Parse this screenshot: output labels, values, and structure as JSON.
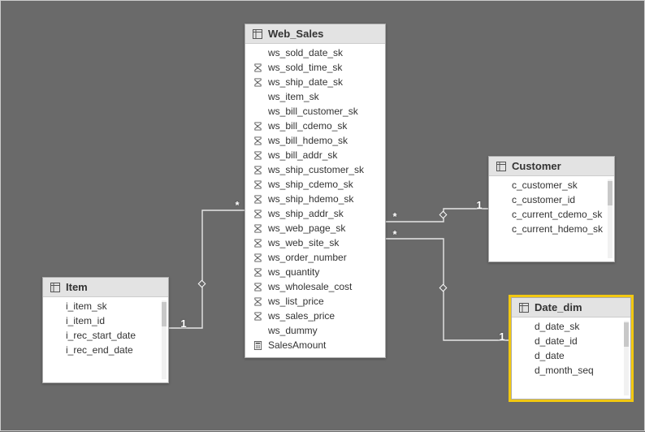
{
  "tables": {
    "item": {
      "title": "Item",
      "fields": [
        {
          "name": "i_item_sk",
          "icon": ""
        },
        {
          "name": "i_item_id",
          "icon": ""
        },
        {
          "name": "i_rec_start_date",
          "icon": ""
        },
        {
          "name": "i_rec_end_date",
          "icon": ""
        }
      ]
    },
    "web_sales": {
      "title": "Web_Sales",
      "fields": [
        {
          "name": "ws_sold_date_sk",
          "icon": ""
        },
        {
          "name": "ws_sold_time_sk",
          "icon": "sigma"
        },
        {
          "name": "ws_ship_date_sk",
          "icon": "sigma"
        },
        {
          "name": "ws_item_sk",
          "icon": ""
        },
        {
          "name": "ws_bill_customer_sk",
          "icon": ""
        },
        {
          "name": "ws_bill_cdemo_sk",
          "icon": "sigma"
        },
        {
          "name": "ws_bill_hdemo_sk",
          "icon": "sigma"
        },
        {
          "name": "ws_bill_addr_sk",
          "icon": "sigma"
        },
        {
          "name": "ws_ship_customer_sk",
          "icon": "sigma"
        },
        {
          "name": "ws_ship_cdemo_sk",
          "icon": "sigma"
        },
        {
          "name": "ws_ship_hdemo_sk",
          "icon": "sigma"
        },
        {
          "name": "ws_ship_addr_sk",
          "icon": "sigma"
        },
        {
          "name": "ws_web_page_sk",
          "icon": "sigma"
        },
        {
          "name": "ws_web_site_sk",
          "icon": "sigma"
        },
        {
          "name": "ws_order_number",
          "icon": "sigma"
        },
        {
          "name": "ws_quantity",
          "icon": "sigma"
        },
        {
          "name": "ws_wholesale_cost",
          "icon": "sigma"
        },
        {
          "name": "ws_list_price",
          "icon": "sigma"
        },
        {
          "name": "ws_sales_price",
          "icon": "sigma"
        },
        {
          "name": "ws_dummy",
          "icon": ""
        },
        {
          "name": "SalesAmount",
          "icon": "calc"
        }
      ]
    },
    "customer": {
      "title": "Customer",
      "fields": [
        {
          "name": "c_customer_sk",
          "icon": ""
        },
        {
          "name": "c_customer_id",
          "icon": ""
        },
        {
          "name": "c_current_cdemo_sk",
          "icon": ""
        },
        {
          "name": "c_current_hdemo_sk",
          "icon": ""
        }
      ]
    },
    "date_dim": {
      "title": "Date_dim",
      "fields": [
        {
          "name": "d_date_sk",
          "icon": ""
        },
        {
          "name": "d_date_id",
          "icon": ""
        },
        {
          "name": "d_date",
          "icon": ""
        },
        {
          "name": "d_month_seq",
          "icon": ""
        }
      ]
    }
  },
  "relationships": [
    {
      "from": "item",
      "to": "web_sales",
      "from_card": "1",
      "to_card": "*"
    },
    {
      "from": "customer",
      "to": "web_sales",
      "from_card": "1",
      "to_card": "*"
    },
    {
      "from": "date_dim",
      "to": "web_sales",
      "from_card": "1",
      "to_card": "*"
    }
  ],
  "labels": {
    "item_one": "1",
    "ws_item_star": "*",
    "cust_one": "1",
    "ws_cust_star": "*",
    "date_one": "1",
    "ws_date_star": "*"
  }
}
